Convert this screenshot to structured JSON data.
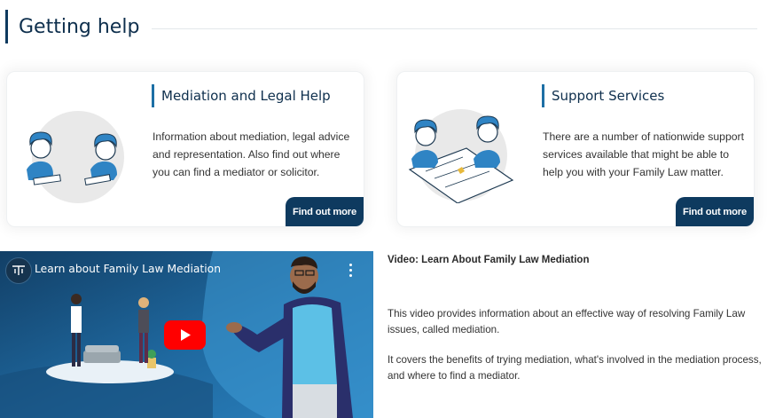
{
  "heading": {
    "title": "Getting help"
  },
  "cards": [
    {
      "title": "Mediation and Legal Help",
      "description": "Information about mediation, legal advice and representation. Also find out where you can find a mediator or solicitor.",
      "button": "Find out more"
    },
    {
      "title": "Support Services",
      "description": "There are a number of nationwide support services available that might be able to help you with your Family Law matter.",
      "button": "Find out more"
    }
  ],
  "video": {
    "player_title": "Learn about Family Law Mediation",
    "heading": "Video: Learn About Family Law Mediation",
    "paragraphs": [
      "This video provides information about an effective way of resolving Family Law issues, called mediation.",
      "It covers the benefits of trying mediation, what's involved in the mediation process, and where to find a mediator."
    ]
  },
  "colors": {
    "navy": "#0e3a5f",
    "accent": "#1d6fa5",
    "illustration_blue": "#2f84c4",
    "youtube_red": "#ff0000"
  },
  "icons": [
    "play-icon",
    "more-options-icon",
    "channel-logo-icon"
  ]
}
